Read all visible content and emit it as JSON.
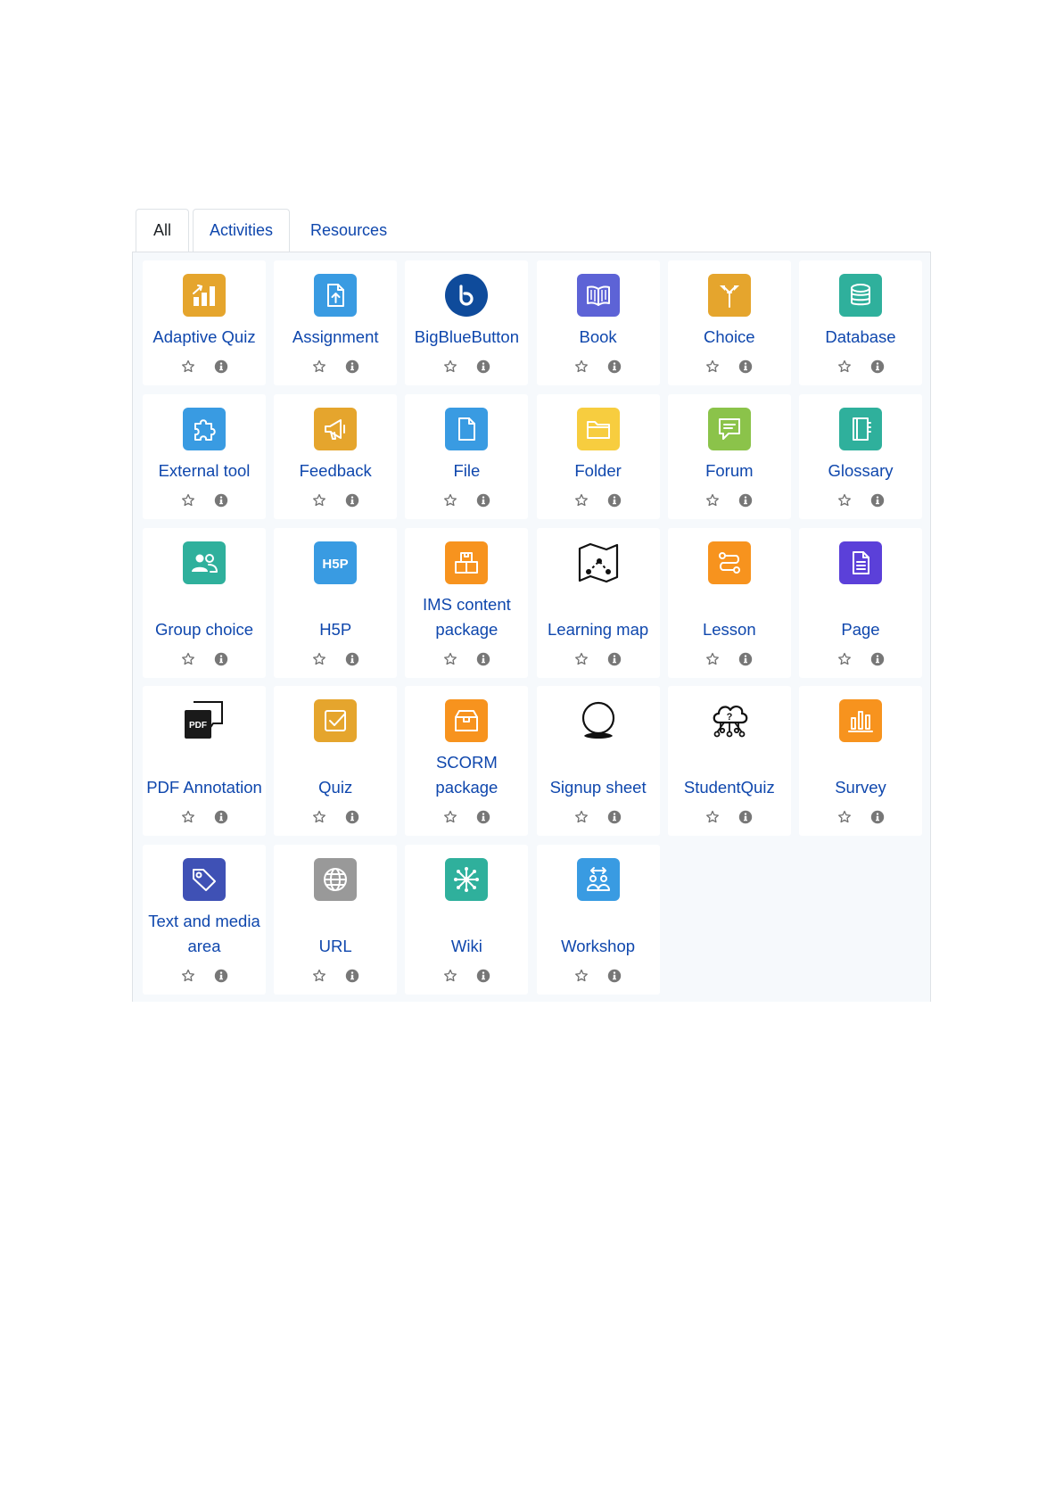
{
  "tabs": [
    "All",
    "Activities",
    "Resources"
  ],
  "modules": [
    {
      "label": "Adaptive Quiz",
      "icon": "adaptive-quiz-icon",
      "color": "#e5a52d"
    },
    {
      "label": "Assignment",
      "icon": "assignment-icon",
      "color": "#399be2"
    },
    {
      "label": "BigBlueButton",
      "icon": "bigbluebutton-icon",
      "color": "#0f4b9b"
    },
    {
      "label": "Book",
      "icon": "book-icon",
      "color": "#5d63d6"
    },
    {
      "label": "Choice",
      "icon": "choice-icon",
      "color": "#e5a52d"
    },
    {
      "label": "Database",
      "icon": "database-icon",
      "color": "#2fb09c"
    },
    {
      "label": "External tool",
      "icon": "external-tool-icon",
      "color": "#399be2"
    },
    {
      "label": "Feedback",
      "icon": "feedback-icon",
      "color": "#e5a52d"
    },
    {
      "label": "File",
      "icon": "file-icon",
      "color": "#399be2"
    },
    {
      "label": "Folder",
      "icon": "folder-icon",
      "color": "#f7cd3f"
    },
    {
      "label": "Forum",
      "icon": "forum-icon",
      "color": "#8bc34a"
    },
    {
      "label": "Glossary",
      "icon": "glossary-icon",
      "color": "#2fb09c"
    },
    {
      "label": "Group choice",
      "icon": "group-choice-icon",
      "color": "#2fb09c"
    },
    {
      "label": "H5P",
      "icon": "h5p-icon",
      "color": "#399be2"
    },
    {
      "label": "IMS content package",
      "icon": "ims-package-icon",
      "color": "#f7931e"
    },
    {
      "label": "Learning map",
      "icon": "learning-map-icon",
      "color": "#000000"
    },
    {
      "label": "Lesson",
      "icon": "lesson-icon",
      "color": "#f7931e"
    },
    {
      "label": "Page",
      "icon": "page-icon",
      "color": "#5b40d9"
    },
    {
      "label": "PDF Annotation",
      "icon": "pdf-annotation-icon",
      "color": "#000000"
    },
    {
      "label": "Quiz",
      "icon": "quiz-icon",
      "color": "#e5a52d"
    },
    {
      "label": "SCORM package",
      "icon": "scorm-icon",
      "color": "#f7931e"
    },
    {
      "label": "Signup sheet",
      "icon": "signup-sheet-icon",
      "color": "#000000"
    },
    {
      "label": "StudentQuiz",
      "icon": "studentquiz-icon",
      "color": "#000000"
    },
    {
      "label": "Survey",
      "icon": "survey-icon",
      "color": "#f7931e"
    },
    {
      "label": "Text and media area",
      "icon": "text-media-icon",
      "color": "#3f51b5"
    },
    {
      "label": "URL",
      "icon": "url-icon",
      "color": "#999999"
    },
    {
      "label": "Wiki",
      "icon": "wiki-icon",
      "color": "#2fb09c"
    },
    {
      "label": "Workshop",
      "icon": "workshop-icon",
      "color": "#399be2"
    }
  ],
  "action_icons": {
    "favourite": "star-outline-icon",
    "info": "info-circle-icon"
  }
}
